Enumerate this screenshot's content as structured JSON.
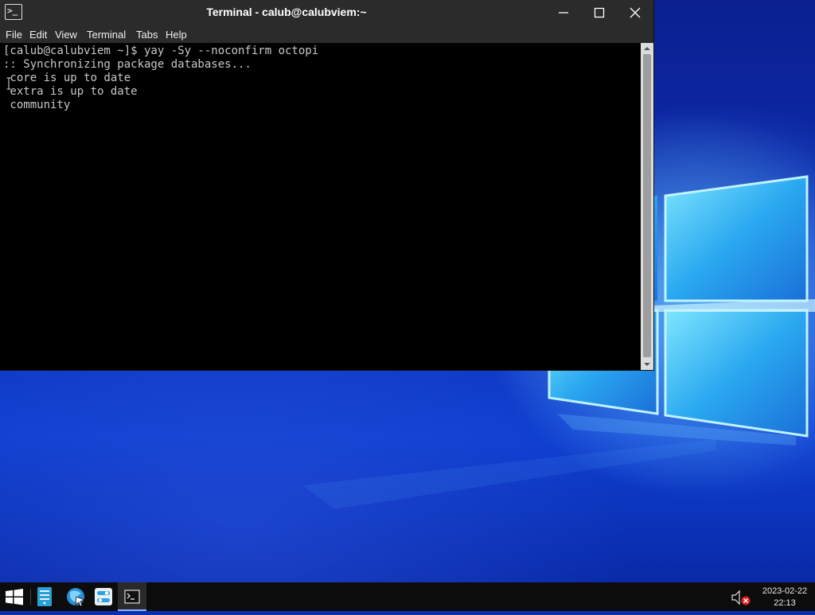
{
  "window": {
    "title": "Terminal - calub@calubviem:~",
    "icon": "terminal-icon",
    "controls": [
      "minimize",
      "maximize",
      "close"
    ]
  },
  "menubar": {
    "items": [
      "File",
      "Edit",
      "View",
      "Terminal",
      "Tabs",
      "Help"
    ]
  },
  "terminal": {
    "lines": [
      "[calub@calubviem ~]$ yay -Sy --noconfirm octopi",
      ":: Synchronizing package databases...",
      " core is up to date",
      " extra is up to date",
      " community"
    ]
  },
  "taskbar": {
    "apps": [
      "windows-start-icon",
      "file-manager-icon",
      "browser-icon",
      "settings-icon",
      "terminal-icon"
    ],
    "volume_icon": "volume-muted-icon",
    "clock": {
      "date": "2023-02-22",
      "time": "22:13"
    }
  },
  "colors": {
    "titlebar": "#2b2b2b",
    "terminal_bg": "#000000",
    "terminal_fg": "#c8c8c8",
    "taskbar": "#0c0c0c",
    "desktop_blue": "#0d2fb8",
    "logo_glow": "#5ad8ff"
  }
}
